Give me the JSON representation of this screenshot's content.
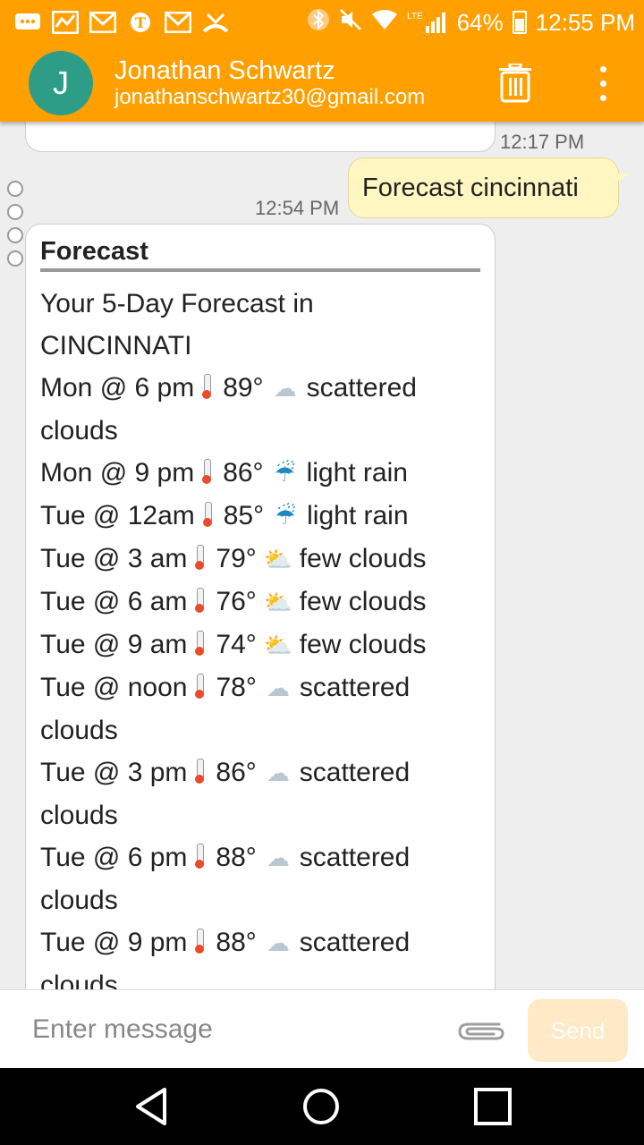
{
  "status_bar": {
    "battery": "64%",
    "time": "12:55 PM",
    "lte_label": "LTE"
  },
  "header": {
    "avatar_letter": "J",
    "name": "Jonathan Schwartz",
    "email": "jonathanschwartz30@gmail.com"
  },
  "chat": {
    "prev_time": "12:17 PM",
    "sent_text": "Forecast cincinnati",
    "reply_time": "12:54 PM",
    "card_title": "Forecast",
    "intro_line1": "Your 5-Day Forecast in",
    "intro_line2": "CINCINNATI",
    "forecast": [
      {
        "when": "Mon @ 6 pm",
        "temp": "89°",
        "icon": "cloud-icon",
        "desc": "scattered",
        "desc2": "clouds"
      },
      {
        "when": "Mon @ 9 pm",
        "temp": "86°",
        "icon": "umbrella-rain-icon",
        "desc": "light rain"
      },
      {
        "when": "Tue @ 12am",
        "temp": "85°",
        "icon": "umbrella-rain-icon",
        "desc": "light rain"
      },
      {
        "when": "Tue @ 3 am",
        "temp": "79°",
        "icon": "sun-behind-cloud-icon",
        "desc": "few clouds"
      },
      {
        "when": "Tue @ 6 am",
        "temp": "76°",
        "icon": "sun-behind-cloud-icon",
        "desc": "few clouds"
      },
      {
        "when": "Tue @ 9 am",
        "temp": "74°",
        "icon": "sun-behind-cloud-icon",
        "desc": "few clouds"
      },
      {
        "when": "Tue @ noon",
        "temp": "78°",
        "icon": "cloud-icon",
        "desc": "scattered",
        "desc2": "clouds"
      },
      {
        "when": "Tue @ 3 pm",
        "temp": "86°",
        "icon": "cloud-icon",
        "desc": "scattered",
        "desc2": "clouds"
      },
      {
        "when": "Tue @ 6 pm",
        "temp": "88°",
        "icon": "cloud-icon",
        "desc": "scattered",
        "desc2": "clouds"
      },
      {
        "when": "Tue @ 9 pm",
        "temp": "88°",
        "icon": "cloud-icon",
        "desc": "scattered",
        "desc2": "clouds"
      }
    ]
  },
  "composer": {
    "placeholder": "Enter message",
    "send_label": "Send"
  },
  "colors": {
    "accent": "#ffa000",
    "avatar": "#2e9d87",
    "sent_bubble": "#fff6c2",
    "send_disabled": "#ffe9c6"
  }
}
